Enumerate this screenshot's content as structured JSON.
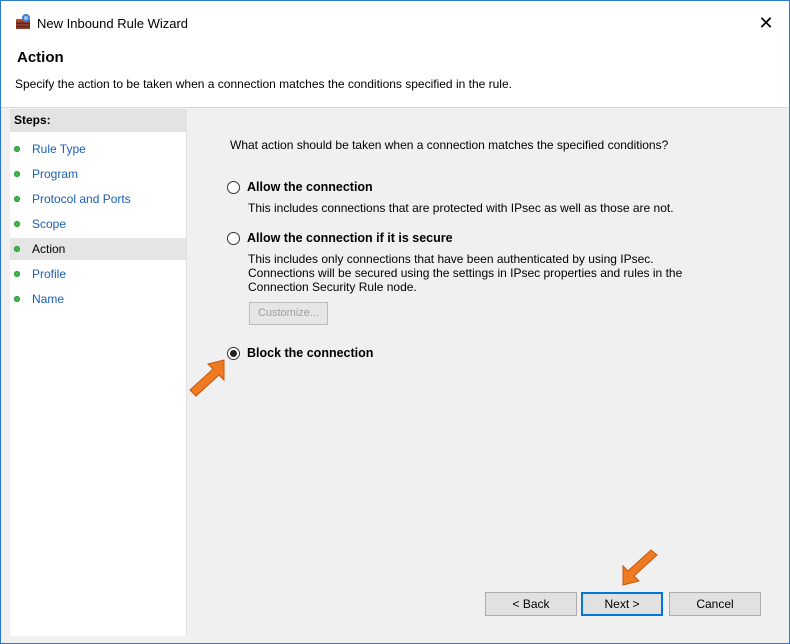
{
  "window": {
    "title": "New Inbound Rule Wizard",
    "close_glyph": "✕"
  },
  "header": {
    "title": "Action",
    "description": "Specify the action to be taken when a connection matches the conditions specified in the rule."
  },
  "steps": {
    "heading": "Steps:",
    "items": [
      {
        "label": "Rule Type"
      },
      {
        "label": "Program"
      },
      {
        "label": "Protocol and Ports"
      },
      {
        "label": "Scope"
      },
      {
        "label": "Action"
      },
      {
        "label": "Profile"
      },
      {
        "label": "Name"
      }
    ],
    "current": "Action"
  },
  "main": {
    "question": "What action should be taken when a connection matches the specified conditions?",
    "options": [
      {
        "label": "Allow the connection",
        "description": "This includes connections that are protected with IPsec as well as those are not.",
        "selected": false
      },
      {
        "label": "Allow the connection if it is secure",
        "description": "This includes only connections that have been authenticated by using IPsec.  Connections will be secured using the settings in IPsec properties and rules in the Connection Security Rule node.",
        "selected": false
      },
      {
        "label": "Block the connection",
        "description": "",
        "selected": true
      }
    ],
    "customize_label": "Customize..."
  },
  "buttons": {
    "back": "< Back",
    "next": "Next >",
    "cancel": "Cancel"
  },
  "colors": {
    "accent": "#0078d7",
    "arrow": "#f07a22",
    "step_dot": "#3fb94a"
  }
}
